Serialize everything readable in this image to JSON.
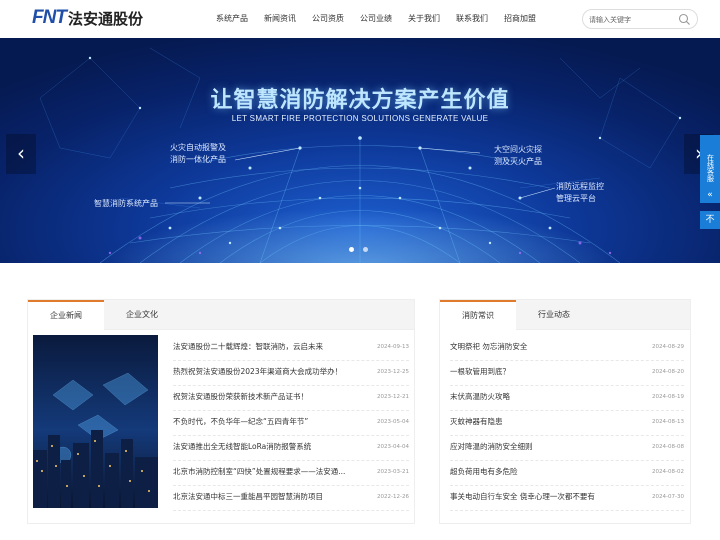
{
  "header": {
    "logo_mark": "FNT",
    "logo_text": "法安通股份",
    "nav": [
      "系统产品",
      "新闻资讯",
      "公司资质",
      "公司业绩",
      "关于我们",
      "联系我们",
      "招商加盟"
    ],
    "search_placeholder": "请输入关键字"
  },
  "banner": {
    "title": "让智慧消防解决方案产生价值",
    "subtitle": "LET SMART FIRE PROTECTION SOLUTIONS GENERATE VALUE",
    "labels": [
      "火灾自动报警及\n消防一体化产品",
      "智慧消防系统产品",
      "大空间火灾探\n测及灭火产品",
      "消防远程监控\n管理云平台"
    ],
    "prev_icon": "chevron-left-icon",
    "next_icon": "chevron-right-icon",
    "slide_count": 2,
    "active_slide": 1
  },
  "side": {
    "customer_service": "在线客服",
    "collapse_icon": "«",
    "top_label": "不"
  },
  "left_panel": {
    "tabs": [
      "企业新闻",
      "企业文化"
    ],
    "active_tab": 0,
    "items": [
      {
        "title": "法安通股份二十载辉煌：智联消防，云启未来",
        "date": "2024-09-13"
      },
      {
        "title": "热烈祝贺法安通股份2023年渠道商大会成功举办！",
        "date": "2023-12-25"
      },
      {
        "title": "祝贺法安通股份荣获新技术新产品证书！",
        "date": "2023-12-21"
      },
      {
        "title": "不负时代，不负华年—纪念“五四青年节”",
        "date": "2023-05-04"
      },
      {
        "title": "法安通推出全无线智能LoRa消防报警系统",
        "date": "2023-04-04"
      },
      {
        "title": "北京市消防控制室“四快”处置规程要求——法安通...",
        "date": "2023-03-21"
      },
      {
        "title": "北京法安通中标三一重能昌平园智慧消防项目",
        "date": "2022-12-26"
      }
    ]
  },
  "right_panel": {
    "tabs": [
      "消防常识",
      "行业动态"
    ],
    "active_tab": 0,
    "items": [
      {
        "title": "文明祭祀 勿忘消防安全",
        "date": "2024-08-29"
      },
      {
        "title": "一根软管用到底？",
        "date": "2024-08-20"
      },
      {
        "title": "末伏高温防火攻略",
        "date": "2024-08-19"
      },
      {
        "title": "灭蚊神器有隐患",
        "date": "2024-08-13"
      },
      {
        "title": "应对降温的消防安全细则",
        "date": "2024-08-08"
      },
      {
        "title": "超负荷用电有多危险",
        "date": "2024-08-02"
      },
      {
        "title": "事关电动自行车安全 侥幸心理一次都不要有",
        "date": "2024-07-30"
      }
    ]
  },
  "colors": {
    "accent": "#e07a2c",
    "brand_blue": "#1f4fa8",
    "side_blue": "#1a7ed8"
  }
}
